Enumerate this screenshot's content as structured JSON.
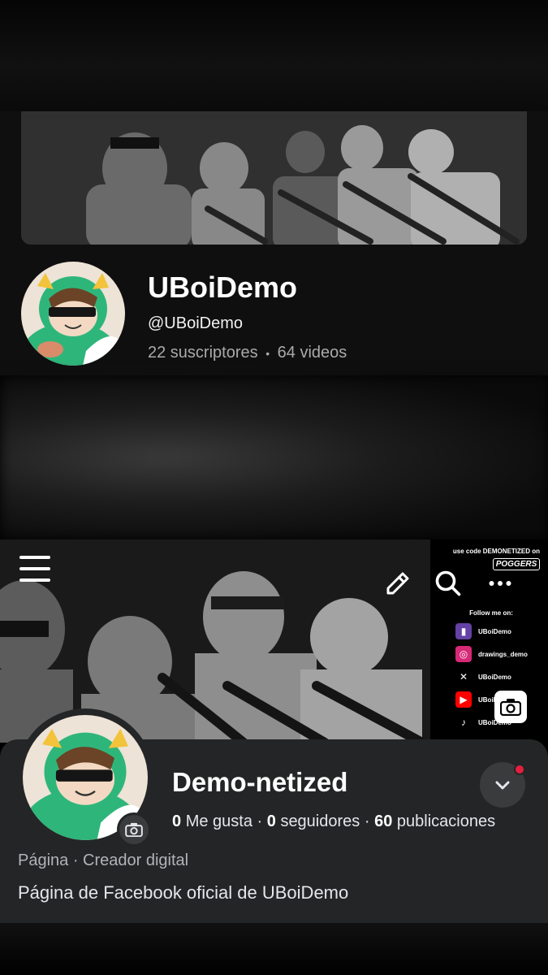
{
  "youtube": {
    "channel_name": "UBoiDemo",
    "handle": "@UBoiDemo",
    "subscribers": "22 suscriptores",
    "separator": "•",
    "videos": "64 videos"
  },
  "facebook": {
    "cover": {
      "promo_text": "use code DEMONETIZED on",
      "promo_brand": "POGGERS",
      "follow_text": "Follow me on:",
      "socials": [
        {
          "icon": "twitch-icon",
          "label": "UBoiDemo",
          "color": "#6441a5"
        },
        {
          "icon": "instagram-icon",
          "label": "drawings_demo",
          "color": "#d62976"
        },
        {
          "icon": "x-icon",
          "label": "UBoiDemo",
          "color": "#000000"
        },
        {
          "icon": "youtube-icon",
          "label": "UBoiDemo",
          "color": "#ff0000"
        },
        {
          "icon": "tiktok-icon",
          "label": "UBoiDemo",
          "color": "#000000"
        }
      ]
    },
    "page_name": "Demo-netized",
    "stats": {
      "likes_count": "0",
      "likes_label": "Me gusta",
      "followers_count": "0",
      "followers_label": "seguidores",
      "posts_count": "60",
      "posts_label": "publicaciones",
      "separator": "·"
    },
    "category": "Página · Creador digital",
    "description": "Página de Facebook oficial de UBoiDemo",
    "colors": {
      "notification_dot": "#e41e3f",
      "card_bg": "#242526"
    }
  }
}
